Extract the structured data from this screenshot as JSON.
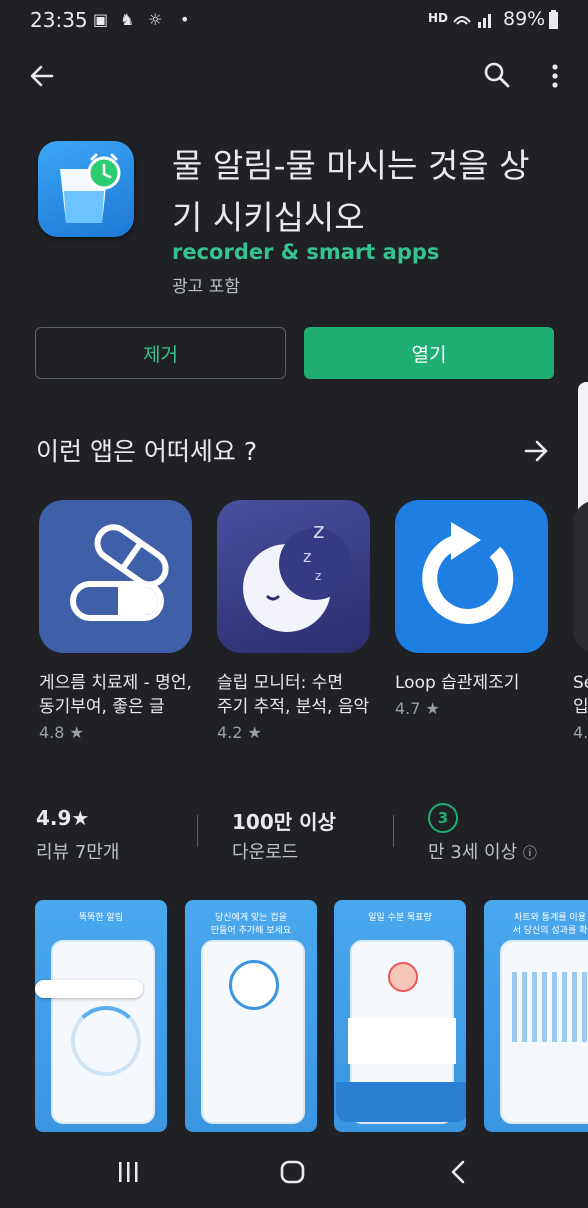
{
  "status_bar": {
    "time": "23:35",
    "battery": "89%",
    "network": "HD"
  },
  "top_bar": {
    "back_icon": "arrow-left-icon",
    "search_icon": "search-icon",
    "more_icon": "more-vert-icon"
  },
  "app": {
    "title": "물 알림-물 마시는 것을 상기 시키십시오",
    "developer": "recorder & smart apps",
    "ads_label": "광고 포함"
  },
  "buttons": {
    "uninstall": "제거",
    "open": "열기"
  },
  "recommendations": {
    "title": "이런 앱은 어떠세요 ?",
    "items": [
      {
        "name": "게으름 치료제 - 명언,\n동기부여, 좋은 글",
        "rating": "4.8 ★"
      },
      {
        "name": "슬립 모니터: 수면\n주기 추적, 분석, 음악",
        "rating": "4.2 ★"
      },
      {
        "name": "Loop 습관제조기",
        "rating": "4.7 ★"
      },
      {
        "name": "Se\n입",
        "rating": "4."
      }
    ]
  },
  "stats": {
    "rating_value": "4.9★",
    "reviews": "리뷰 7만개",
    "downloads_value": "100만 이상",
    "downloads_label": "다운로드",
    "age_badge": "3",
    "age_label": "만 3세 이상"
  },
  "screenshots": [
    {
      "caption": "똑똑한 알림"
    },
    {
      "caption": "당신에게 맞는 컵을\n만들어 추가해 보세요"
    },
    {
      "caption": "일일 수분 목표량"
    },
    {
      "caption": "차트와 통계를 이용\n서 당신의 성과를 확"
    }
  ],
  "accent_color": "#1fae72",
  "developer_color": "#34c38f"
}
